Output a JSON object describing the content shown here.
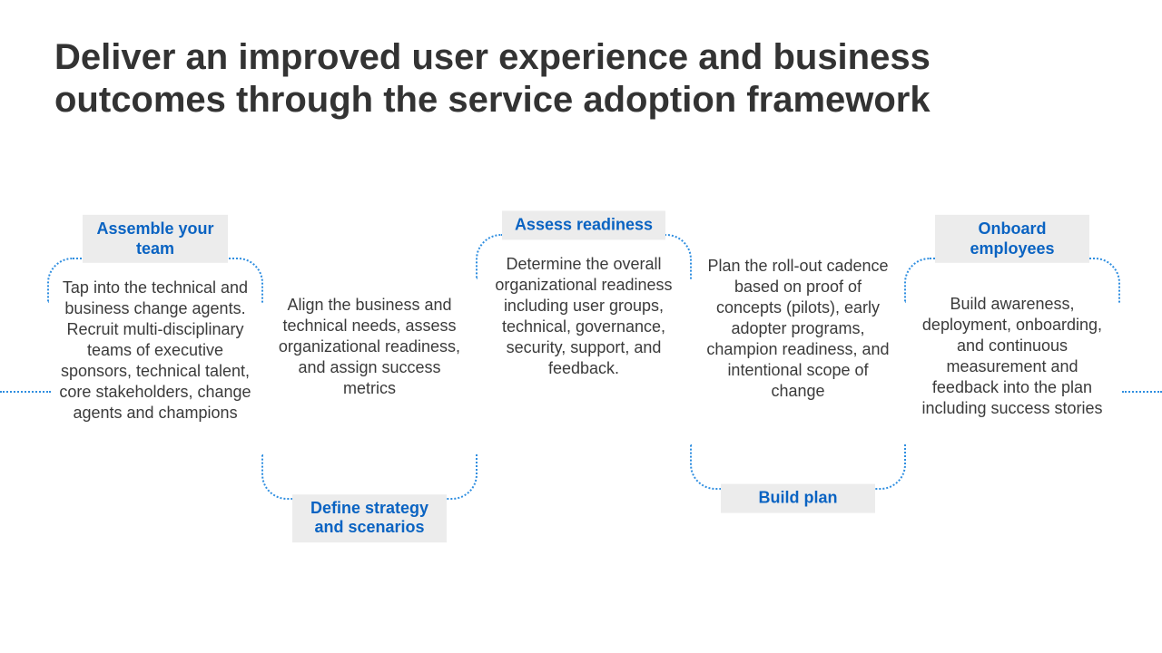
{
  "slide": {
    "title": "Deliver an improved user experience and business outcomes through the service adoption framework"
  },
  "colors": {
    "accent": "#0a63c2",
    "dotted": "#2f8ee0",
    "labelBg": "#ececec"
  },
  "steps": [
    {
      "label": "Assemble your team",
      "labelPosition": "top",
      "body": "Tap into the technical and business change agents. Recruit multi-disciplinary teams of executive sponsors, technical talent, core stakeholders, change agents and champions"
    },
    {
      "label": "Define strategy and scenarios",
      "labelPosition": "bottom",
      "body": "Align the business and technical needs, assess organizational readiness, and assign success metrics"
    },
    {
      "label": "Assess readiness",
      "labelPosition": "top",
      "body": "Determine the overall organizational readiness including user groups, technical, governance, security, support, and feedback."
    },
    {
      "label": "Build plan",
      "labelPosition": "bottom",
      "body": "Plan the roll-out cadence based on proof of concepts (pilots), early adopter programs, champion readiness, and intentional scope of change"
    },
    {
      "label": "Onboard employees",
      "labelPosition": "top",
      "body": "Build awareness, deployment, onboarding, and continuous measurement and feedback into the plan including success stories"
    }
  ]
}
